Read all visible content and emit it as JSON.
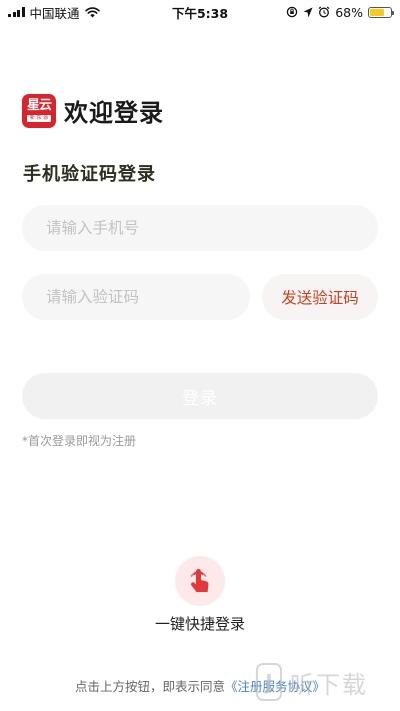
{
  "status_bar": {
    "carrier": "中国联通",
    "time": "下午5:38",
    "battery": "68%",
    "battery_level": 0.68,
    "icons": [
      "signal-icon",
      "wifi-icon",
      "screen-rotation-lock-icon",
      "location-icon",
      "alarm-icon",
      "battery-icon"
    ]
  },
  "header": {
    "logo_main": "星云",
    "logo_sub": "新 东 源",
    "title": "欢迎登录"
  },
  "subtitle": "手机验证码登录",
  "form": {
    "phone_placeholder": "请输入手机号",
    "code_placeholder": "请输入验证码",
    "send_code_label": "发送验证码",
    "login_label": "登录",
    "hint": "*首次登录即视为注册"
  },
  "quick_login": {
    "label": "一键快捷登录",
    "icon": "finger-tap-icon"
  },
  "agreement": {
    "prefix": "点击上方按钮，即表示同意",
    "link": "《注册服务协议》"
  },
  "watermark": {
    "badge": "J",
    "text": "听下载"
  },
  "colors": {
    "accent_red": "#d9232d",
    "send_code_text": "#c8421f",
    "link_blue": "#4a83c6",
    "input_bg": "#f6f6f6",
    "battery_yellow": "#f5cc1b"
  }
}
